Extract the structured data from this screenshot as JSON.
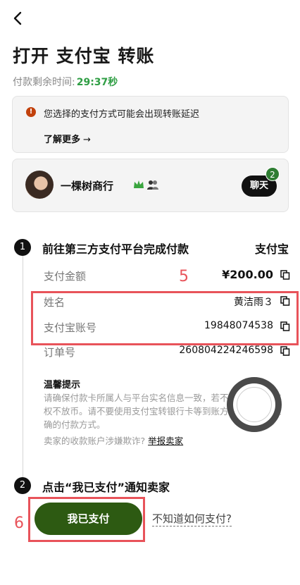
{
  "header": {
    "title": "打开 支付宝 转账"
  },
  "timer": {
    "label": "付款剩余时间:",
    "value": "29:37秒"
  },
  "notice": {
    "message": "您选择的支付方式可能会出现转账延迟",
    "learn_more": "了解更多",
    "arrow": "→",
    "icon": "!"
  },
  "seller": {
    "name": "一棵树商行",
    "chat_label": "聊天",
    "unread": "2"
  },
  "step1": {
    "number": "1",
    "title": "前往第三方支付平台完成付款",
    "method": "支付宝",
    "rows": [
      {
        "label": "支付金额",
        "value": "¥200.00"
      },
      {
        "label": "姓名",
        "value": "黄洁雨３"
      },
      {
        "label": "支付宝账号",
        "value": "19848074538"
      },
      {
        "label": "订单号",
        "value": "260804224246598"
      }
    ]
  },
  "tips": {
    "title": "温馨提示",
    "body": "请确保付款卡所属人与平台实名信息一致，若不一致，卖家有权不放币。请不要使用支付宝转银行卡等到账方式。请使用正确的付款方式。",
    "report_prompt": "卖家的收款账户涉嫌欺诈?",
    "report_link": "举报卖家"
  },
  "step2": {
    "number": "2",
    "title": "点击“我已支付”通知卖家"
  },
  "actions": {
    "paid_button": "我已支付",
    "help_link": "不知道如何支付?"
  },
  "annotations": {
    "a5": "5",
    "a6": "6"
  },
  "colors": {
    "accent_green": "#2d5a12",
    "timer_green": "#2f9e44",
    "annotation_red": "#e8535a"
  }
}
